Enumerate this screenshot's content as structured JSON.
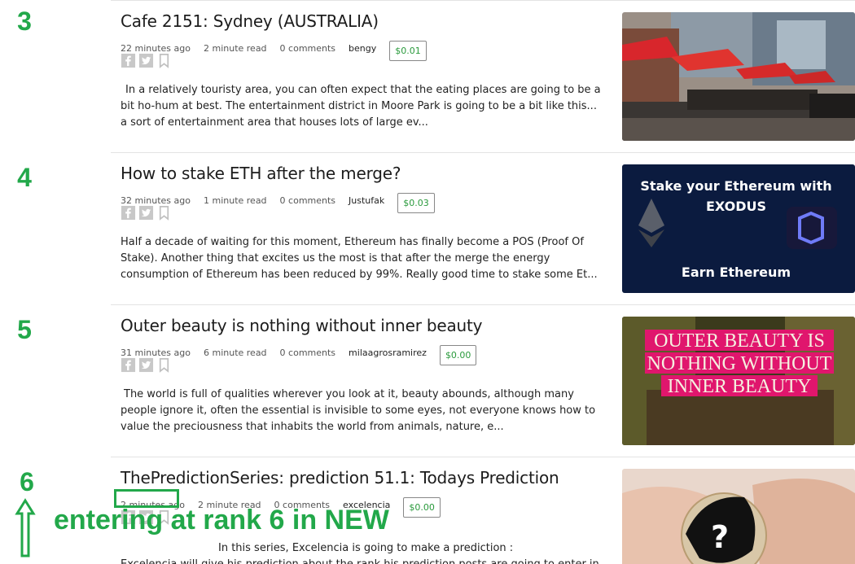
{
  "posts": [
    {
      "rank": "3",
      "title": "Cafe 2151: Sydney (AUSTRALIA)",
      "time": "22 minutes ago",
      "read": "2 minute read",
      "comments": "0 comments",
      "author": "bengy",
      "payout": "$0.01",
      "excerpt": "In a relatively touristy area, you can often expect that the eating places are going to be a bit ho-hum at best. The entertainment district in Moore Park is going to be a bit like this... a sort of entertainment area that houses lots of large ev..."
    },
    {
      "rank": "4",
      "title": "How to stake ETH after the merge?",
      "time": "32 minutes ago",
      "read": "1 minute read",
      "comments": "0 comments",
      "author": "Justufak",
      "payout": "$0.03",
      "excerpt": "Half a decade of waiting for this moment, Ethereum has finally become a POS (Proof Of Stake). Another thing that excites us the most is that after the merge the energy consumption of Ethereum has been reduced by 99%. Really good time to stake some Et...",
      "thumb_text_1": "Stake your Ethereum with",
      "thumb_text_2": "EXODUS",
      "thumb_text_3": "Earn Ethereum"
    },
    {
      "rank": "5",
      "title": "Outer beauty is nothing without inner beauty",
      "time": "31 minutes ago",
      "read": "6 minute read",
      "comments": "0 comments",
      "author": "milaagrosramirez",
      "payout": "$0.00",
      "excerpt": "The world is full of qualities wherever you look at it, beauty abounds, although many people ignore it, often the essential is invisible to some eyes, not everyone knows how to value the preciousness that inhabits the world from animals, nature, e...",
      "thumb_text_1": "OUTER BEAUTY IS",
      "thumb_text_2": "NOTHING WITHOUT",
      "thumb_text_3": "INNER BEAUTY"
    },
    {
      "rank": "6",
      "title": "ThePredictionSeries: prediction 51.1: Todays Prediction",
      "time": "2 minutes ago",
      "read": "2 minute read",
      "comments": "0 comments",
      "author": "excelencia",
      "payout": "$0.00",
      "excerpt": "In this  series, Excelencia is going  to make a  prediction :",
      "excerpt_line2": "Excelencia will give his prediction about the rank his  prediction posts are going to enter in the new"
    }
  ],
  "annotation": {
    "text": "entering at rank 6 in NEW"
  },
  "colors": {
    "annotation_green": "#22a84a",
    "payout_green": "#2a9a3c"
  }
}
